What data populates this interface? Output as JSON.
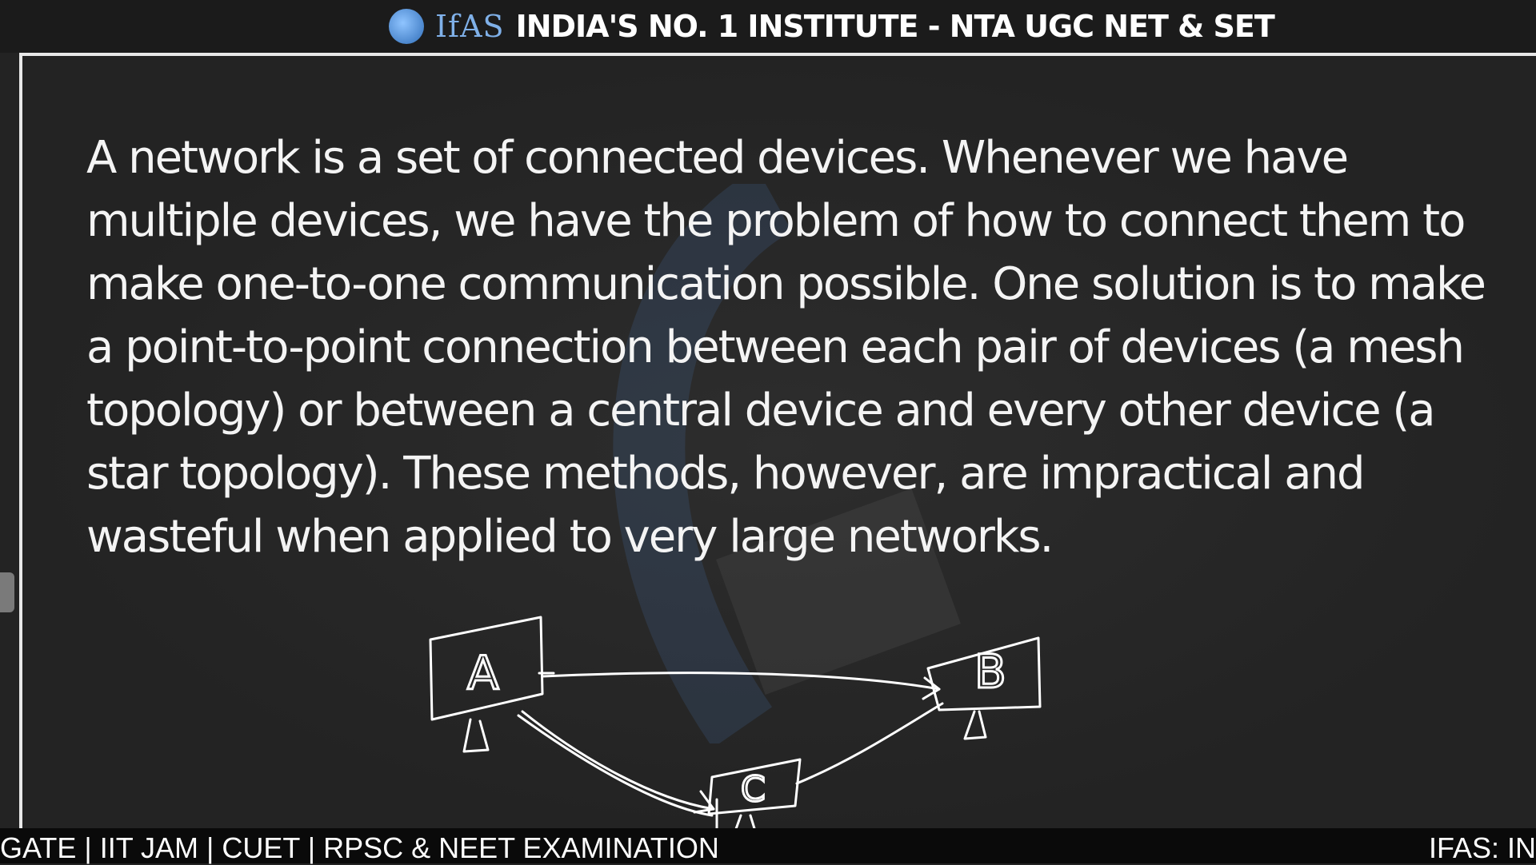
{
  "banner": {
    "brand": "IfAS",
    "title": "INDIA'S NO. 1 INSTITUTE - NTA UGC NET & SET"
  },
  "slide": {
    "paragraph": "A network is a set of connected devices. Whenever we have\nmultiple devices, we have the problem of how to connect them to\nmake one-to-one communication possible. One solution is to make\na point-to-point connection between each pair of devices (a mesh\ntopology) or between a central device and every other device (a\nstar topology). These methods, however, are impractical and\nwasteful when applied to very large networks.",
    "diagram_labels": {
      "a": "A",
      "b": "B",
      "c": "C"
    }
  },
  "ticker": {
    "left": "GATE | IIT JAM | CUET | RPSC & NEET EXAMINATION",
    "right": "IFAS: IN"
  }
}
